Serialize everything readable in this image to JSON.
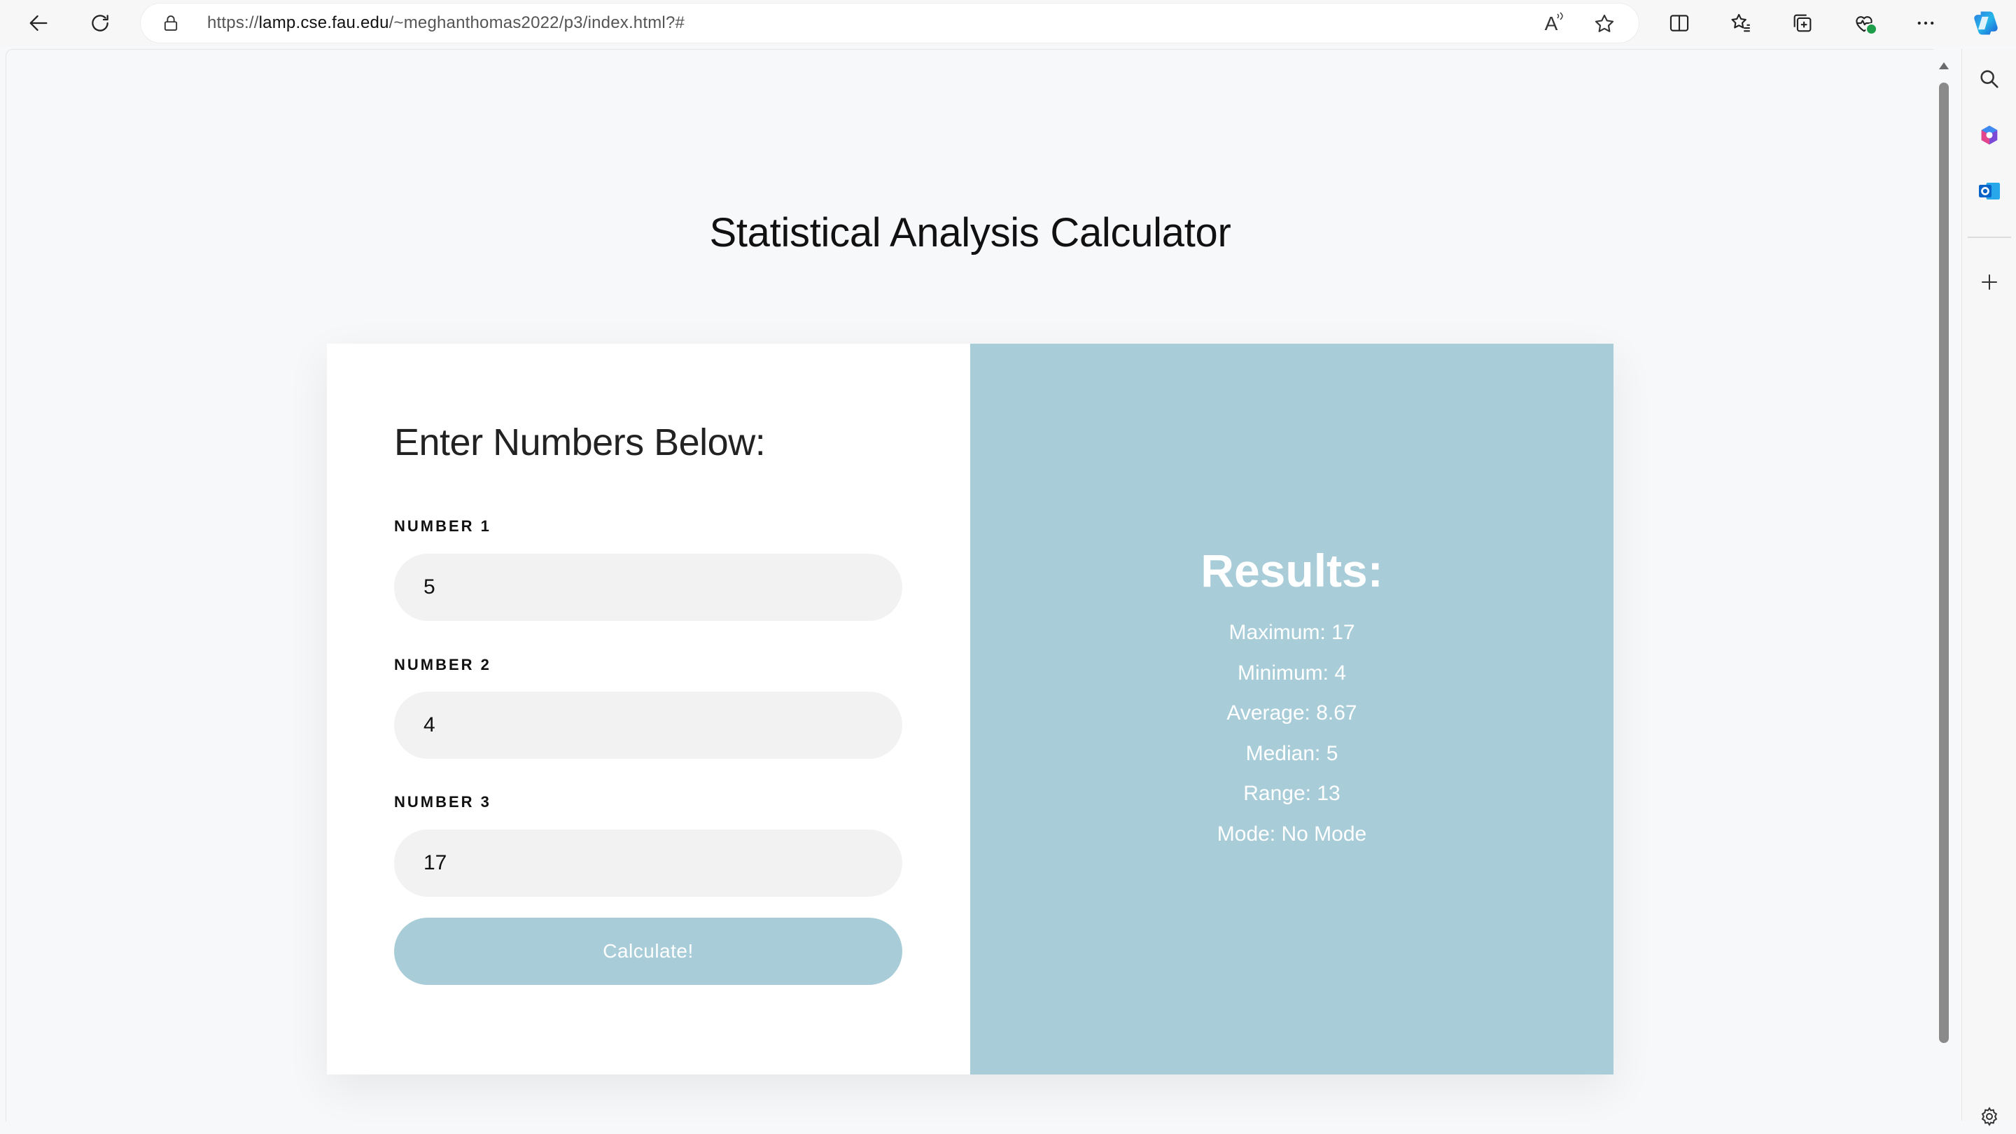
{
  "browser": {
    "url_prefix": "https://",
    "url_host": "lamp.cse.fau.edu",
    "url_path": "/~meghanthomas2022/p3/index.html?#",
    "icons": {
      "back": "arrow-left-icon",
      "refresh": "refresh-icon",
      "lock": "lock-icon",
      "read_aloud": "read-aloud-icon",
      "favorite": "star-icon",
      "split_screen": "split-screen-icon",
      "favorites": "favorites-list-icon",
      "collections": "collections-icon",
      "browser_essentials": "heart-pulse-icon",
      "more": "more-dots-icon",
      "copilot": "copilot-icon"
    },
    "read_aloud_label": "A",
    "sidebar_icons": [
      "search-icon",
      "office-icon",
      "outlook-icon",
      "plus-icon",
      "settings-icon"
    ]
  },
  "page": {
    "title": "Statistical Analysis Calculator",
    "form": {
      "heading": "Enter Numbers Below:",
      "fields": [
        {
          "label": "NUMBER 1",
          "value": "5"
        },
        {
          "label": "NUMBER 2",
          "value": "4"
        },
        {
          "label": "NUMBER 3",
          "value": "17"
        }
      ],
      "button_label": "Calculate!"
    },
    "results": {
      "heading": "Results:",
      "items": [
        "Maximum: 17",
        "Minimum: 4",
        "Average: 8.67",
        "Median: 5",
        "Range: 13",
        "Mode: No Mode"
      ]
    }
  },
  "colors": {
    "accent": "#a8cdd8",
    "input_bg": "#f2f2f2",
    "page_bg": "#f7f8fa"
  }
}
